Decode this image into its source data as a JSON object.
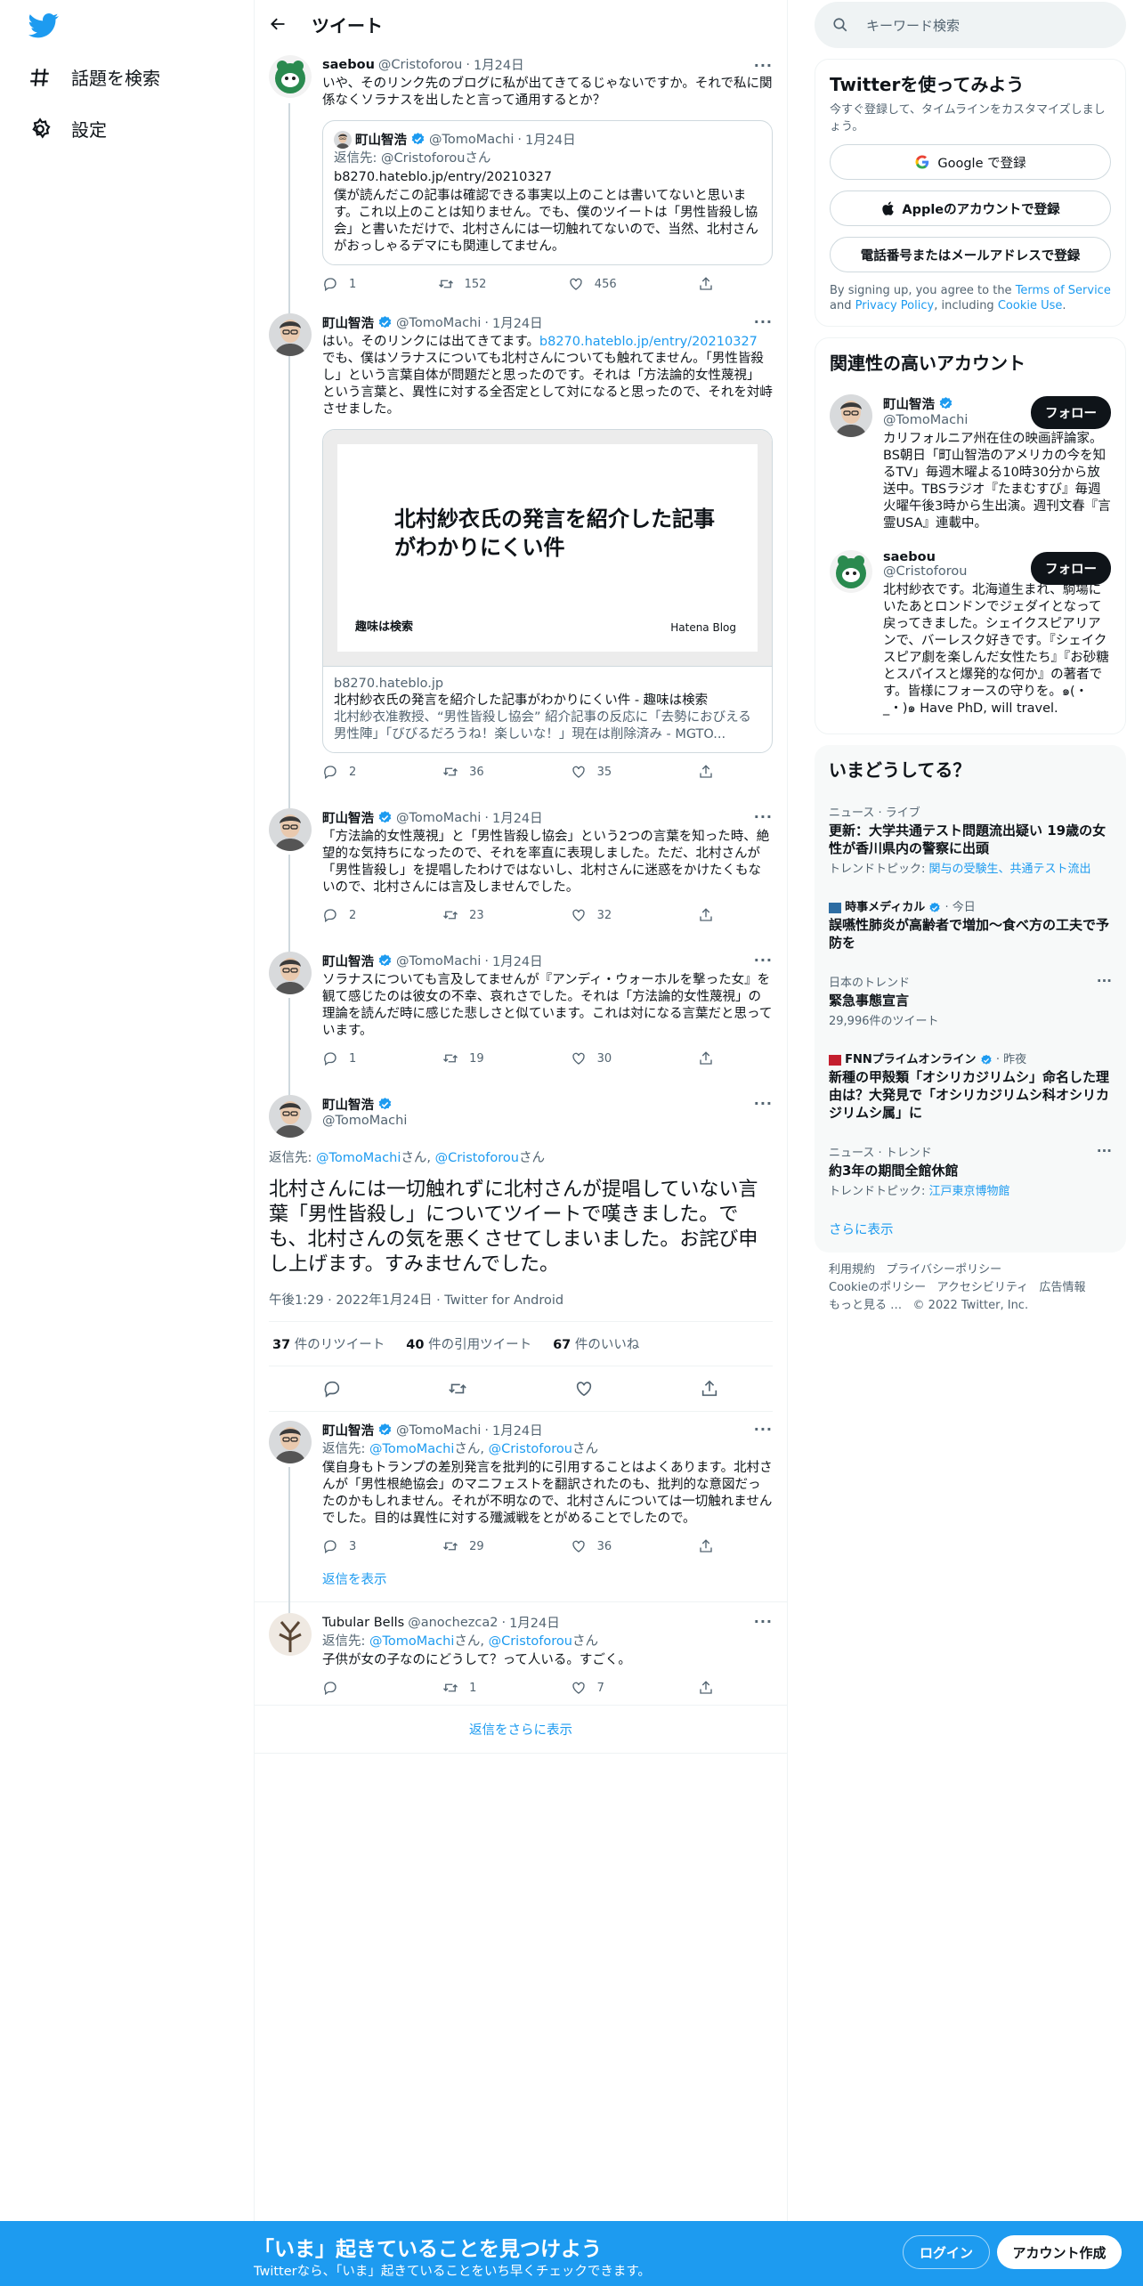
{
  "nav": {
    "explore_label": "話題を検索",
    "settings_label": "設定"
  },
  "header": {
    "title": "ツイート"
  },
  "tweets": {
    "t1": {
      "name": "saebou",
      "handle": "@Cristoforou",
      "date": "1月24日",
      "text": "いや、そのリンク先のブログに私が出てきてるじゃないですか。それで私に関係なくソラナスを出したと言って通用するとか？",
      "quote": {
        "name": "町山智浩",
        "handle": "@TomoMachi",
        "date": "1月24日",
        "reply_prefix": "返信先:",
        "reply_to": "@Cristoforou",
        "reply_suffix": "さん",
        "link": "b8270.hateblo.jp/entry/20210327",
        "text": "僕が読んだこの記事は確認できる事実以上のことは書いてないと思います。これ以上のことは知りません。でも、僕のツイートは「男性皆殺し協会」と書いただけで、北村さんには一切触れてないので、当然、北村さんがおっしゃるデマにも関連してません。"
      },
      "replies": "1",
      "retweets": "152",
      "likes": "456"
    },
    "t2": {
      "name": "町山智浩",
      "handle": "@TomoMachi",
      "date": "1月24日",
      "text_a": "はい。そのリンクには出てきてます。",
      "link": "b8270.hateblo.jp/entry/20210327",
      "text_b": "でも、僕はソラナスについても北村さんについても触れてません。「男性皆殺し」という言葉自体が問題だと思ったのです。それは「方法論的女性蔑視」という言葉と、異性に対する全否定として対になると思ったので、それを対峙させました。",
      "card": {
        "image_title": "北村紗衣氏の発言を紹介した記事がわかりにくい件",
        "image_blog": "趣味は検索",
        "image_brand": "Hatena Blog",
        "domain": "b8270.hateblo.jp",
        "title": "北村紗衣氏の発言を紹介した記事がわかりにくい件 - 趣味は検索",
        "desc": "北村紗衣准教授、“男性皆殺し協会” 紹介記事の反応に「去勢におびえる男性陣」「びびるだろうね！楽しいな！」現在は削除済み - MGTO..."
      },
      "replies": "2",
      "retweets": "36",
      "likes": "35"
    },
    "t3": {
      "name": "町山智浩",
      "handle": "@TomoMachi",
      "date": "1月24日",
      "text": "「方法論的女性蔑視」と「男性皆殺し協会」という2つの言葉を知った時、絶望的な気持ちになったので、それを率直に表現しました。ただ、北村さんが「男性皆殺し」を提唱したわけではないし、北村さんに迷惑をかけたくもないので、北村さんには言及しませんでした。",
      "replies": "2",
      "retweets": "23",
      "likes": "32"
    },
    "t4": {
      "name": "町山智浩",
      "handle": "@TomoMachi",
      "date": "1月24日",
      "text": "ソラナスについても言及してませんが『アンディ・ウォーホルを撃った女』を観て感じたのは彼女の不幸、哀れさでした。それは「方法論的女性蔑視」の理論を読んだ時に感じた悲しさと似ています。これは対になる言葉だと思っています。",
      "replies": "1",
      "retweets": "19",
      "likes": "30"
    },
    "main": {
      "name": "町山智浩",
      "handle": "@TomoMachi",
      "reply_prefix": "返信先:",
      "reply_to1": "@TomoMachi",
      "reply_sep": "さん,",
      "reply_to2": "@Cristoforou",
      "reply_suffix": "さん",
      "text": "北村さんには一切触れずに北村さんが提唱していない言葉「男性皆殺し」についてツイートで嘆きました。でも、北村さんの気を悪くさせてしまいました。お詫び申し上げます。すみませんでした。",
      "timestamp": "午後1:29 · 2022年1月24日 · Twitter for Android",
      "retweets": "37",
      "retweets_label": "件のリツイート",
      "quotes": "40",
      "quotes_label": "件の引用ツイート",
      "likes": "67",
      "likes_label": "件のいいね"
    },
    "t6": {
      "name": "町山智浩",
      "handle": "@TomoMachi",
      "date": "1月24日",
      "reply_prefix": "返信先:",
      "reply_to1": "@TomoMachi",
      "reply_sep": "さん,",
      "reply_to2": "@Cristoforou",
      "reply_suffix": "さん",
      "text": "僕自身もトランプの差別発言を批判的に引用することはよくあります。北村さんが「男性根絶協会」のマニフェストを翻訳されたのも、批判的な意図だったのかもしれません。それが不明なので、北村さんについては一切触れませんでした。目的は異性に対する殲滅戦をとがめることでしたので。",
      "replies": "3",
      "retweets": "29",
      "likes": "36",
      "show_replies": "返信を表示"
    },
    "t7": {
      "name": "Tubular Bells",
      "handle": "@anochezca2",
      "date": "1月24日",
      "reply_prefix": "返信先:",
      "reply_to1": "@TomoMachi",
      "reply_sep": "さん,",
      "reply_to2": "@Cristoforou",
      "reply_suffix": "さん",
      "text": "子供が女の子なのにどうして？って人いる。すごく。",
      "replies": "",
      "retweets": "1",
      "likes": "7"
    },
    "more_replies": "返信をさらに表示"
  },
  "right": {
    "search_placeholder": "キーワード検索",
    "signup": {
      "title": "Twitterを使ってみよう",
      "subtitle": "今すぐ登録して、タイムラインをカスタマイズしましょう。",
      "google": "Google で登録",
      "apple": "Appleのアカウントで登録",
      "phone": "電話番号またはメールアドレスで登録",
      "legal_a": "By signing up, you agree to the",
      "terms": "Terms of Service",
      "legal_and": "and",
      "privacy": "Privacy Policy",
      "legal_incl": ", including",
      "cookie": "Cookie Use",
      "legal_end": "."
    },
    "relevant": {
      "title": "関連性の高いアカウント",
      "follow": "フォロー",
      "a1": {
        "name": "町山智浩",
        "handle": "@TomoMachi",
        "bio": "カリフォルニア州在住の映画評論家。BS朝日「町山智浩のアメリカの今を知るTV」毎週木曜よる10時30分から放送中。TBSラジオ『たまむすび』毎週火曜午後3時から生出演。週刊文春『言霊USA』連載中。"
      },
      "a2": {
        "name": "saebou",
        "handle": "@Cristoforou",
        "bio": "北村紗衣です。北海道生まれ、駒場にいたあとロンドンでジェダイとなって戻ってきました。シェイクスピアリアンで、バーレスク好きです。『シェイクスピア劇を楽しんだ女性たち』『お砂糖とスパイスと爆発的な何か』の著者です。皆様にフォースの守りを。๑(・_・)๑ Have PhD, will travel."
      }
    },
    "trends": {
      "title": "いまどうしてる？",
      "items": [
        {
          "cap": "ニュース · ライブ",
          "title": "更新：大学共通テスト問題流出疑い 19歳の女性が香川県内の警察に出頭",
          "sub_prefix": "トレンドトピック:",
          "sub_link": "関与の受験生、共通テスト流出"
        },
        {
          "cap_source": "時事メディカル",
          "cap_when": "· 今日",
          "title": "誤嚥性肺炎が高齢者で増加～食べ方の工夫で予防を"
        },
        {
          "cap": "日本のトレンド",
          "title": "緊急事態宣言",
          "sub": "29,996件のツイート"
        },
        {
          "cap_source": "FNNプライムオンライン",
          "cap_when": "· 昨夜",
          "title": "新種の甲殻類「オシリカジリムシ」命名した理由は？大発見で「オシリカジリムシ科オシリカジリムシ属」に"
        },
        {
          "cap": "ニュース · トレンド",
          "title": "約3年の期間全館休館",
          "sub_prefix": "トレンドトピック:",
          "sub_link": "江戸東京博物館"
        }
      ],
      "more": "さらに表示"
    },
    "footer": {
      "terms": "利用規約",
      "privacy": "プライバシーポリシー",
      "cookie": "Cookieのポリシー",
      "access": "アクセシビリティ",
      "ads": "広告情報",
      "more": "もっと見る …",
      "copy": "© 2022 Twitter, Inc."
    }
  },
  "bottombar": {
    "title": "「いま」起きていることを見つけよう",
    "subtitle": "Twitterなら、「いま」起きていることをいち早くチェックできます。",
    "login": "ログイン",
    "signup": "アカウント作成"
  },
  "colors": {
    "accent": "#1d9bf0",
    "text": "#0f1419",
    "muted": "#536471"
  }
}
